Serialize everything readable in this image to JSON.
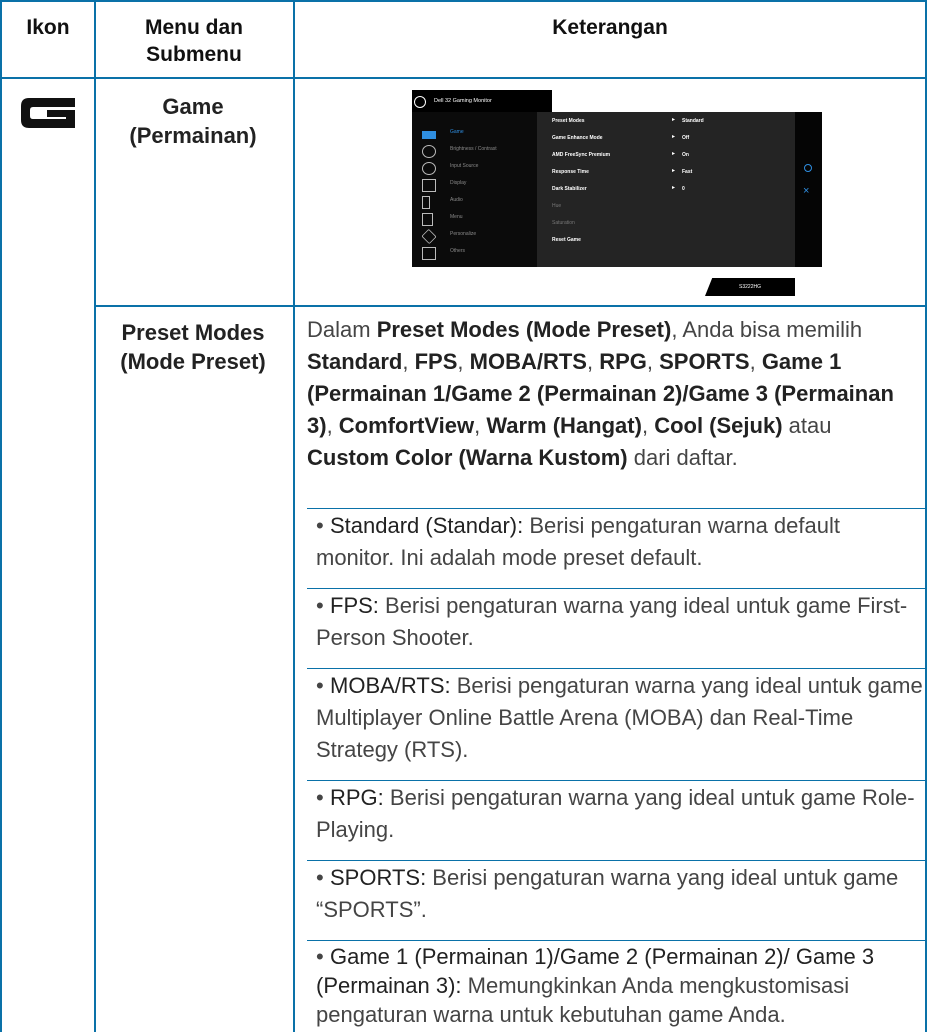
{
  "header": {
    "col1": "Ikon",
    "col2": "Menu dan Submenu",
    "col3": "Keterangan"
  },
  "row_game": {
    "icon": "game-g-icon",
    "menu": "Game (Permainan)",
    "osd": {
      "title": "Dell 32 Gaming Monitor",
      "menu_items": [
        "Game",
        "Brightness / Contrast",
        "Input Source",
        "Display",
        "Audio",
        "Menu",
        "Personalize",
        "Others"
      ],
      "settings": [
        {
          "name": "Preset Modes",
          "value": "Standard"
        },
        {
          "name": "Game Enhance Mode",
          "value": "Off"
        },
        {
          "name": "AMD FreeSync Premium",
          "value": "On"
        },
        {
          "name": "Response Time",
          "value": "Fast"
        },
        {
          "name": "Dark Stabilizer",
          "value": "0"
        },
        {
          "name": "Hue",
          "value": ""
        },
        {
          "name": "Saturation",
          "value": ""
        },
        {
          "name": "Reset Game",
          "value": ""
        }
      ],
      "model": "S3222HG"
    }
  },
  "row_preset": {
    "menu": "Preset Modes (Mode Preset)",
    "intro": {
      "t1": "Dalam ",
      "k1": "Preset Modes (Mode Preset)",
      "t2": ", Anda bisa memilih ",
      "k2": "Standard",
      "t3": ", ",
      "k3": "FPS",
      "t4": ", ",
      "k4": "MOBA/RTS",
      "t5": ", ",
      "k5": "RPG",
      "t6": ", ",
      "k6": "SPORTS",
      "t7": ", ",
      "k7": "Game 1 (Permainan 1/Game 2 (Permainan 2)/Game 3 (Permainan 3)",
      "t8": ", ",
      "k8": "ComfortView",
      "t9": ", ",
      "k9": "Warm (Hangat)",
      "t10": ", ",
      "k10": "Cool (Sejuk)",
      "t11": " atau ",
      "k11": "Custom Color (Warna Kustom)",
      "t12": " dari daftar."
    },
    "bullets": [
      {
        "label": "Standard (Standar):",
        "text": " Berisi pengaturan warna default monitor. Ini adalah mode preset default."
      },
      {
        "label": "FPS:",
        "text": " Berisi pengaturan warna yang ideal untuk game First-Person Shooter."
      },
      {
        "label": "MOBA/RTS:",
        "text": " Berisi pengaturan warna yang ideal untuk game Multiplayer Online Battle Arena (MOBA) dan Real-Time Strategy (RTS)."
      },
      {
        "label": "RPG:",
        "text": " Berisi pengaturan warna yang ideal untuk game Role-Playing."
      },
      {
        "label": "SPORTS:",
        "text": " Berisi pengaturan warna yang ideal untuk game “SPORTS”."
      },
      {
        "label": "Game 1 (Permainan 1)/Game 2 (Permainan 2)/ Game 3 (Permainan 3):",
        "text": " Memungkinkan Anda mengkustomisasi pengaturan warna untuk kebutuhan game Anda."
      }
    ]
  }
}
